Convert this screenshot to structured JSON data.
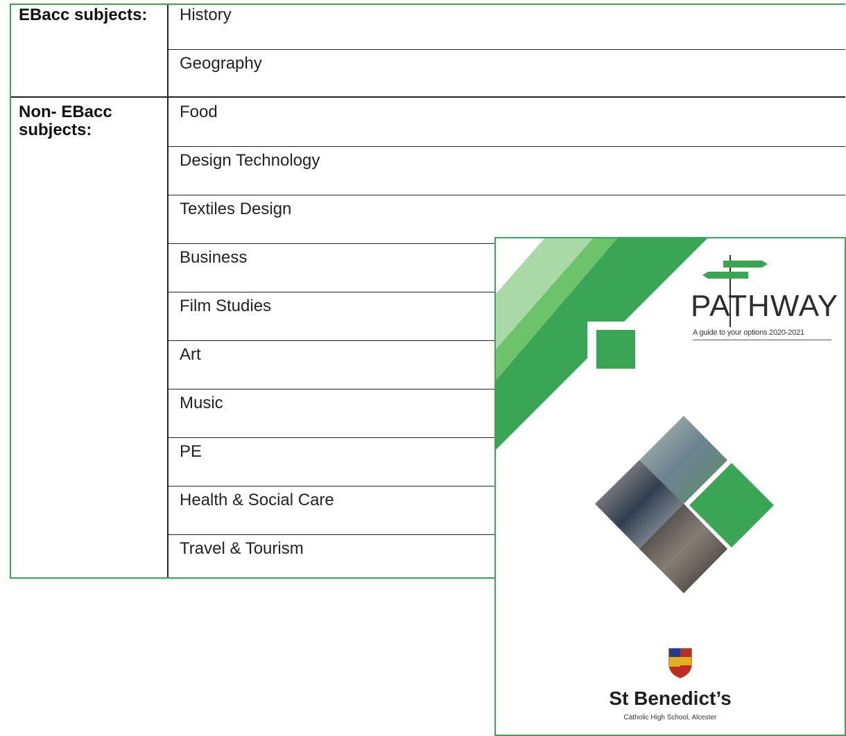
{
  "table": {
    "groups": [
      {
        "label": "EBacc subjects:",
        "subjects": [
          "History",
          "Geography"
        ]
      },
      {
        "label": "Non- EBacc subjects:",
        "subjects": [
          "Food",
          "Design Technology",
          "Textiles Design",
          "Business",
          "Film Studies",
          "Art",
          "Music",
          "PE",
          "Health & Social Care",
          "Travel & Tourism"
        ]
      }
    ]
  },
  "brochure": {
    "title": "PATHWAY",
    "subtitle": "A guide to your options 2020-2021",
    "school_name": "St Benedict’s",
    "school_subtitle": "Catholic High School, Alcester",
    "logo": "signpost-icon",
    "crest": "school-crest-icon"
  },
  "colors": {
    "accent_green": "#3aa655",
    "light_green": "#a9d9a6",
    "mid_green": "#58b858",
    "border_green": "#3aa655"
  }
}
